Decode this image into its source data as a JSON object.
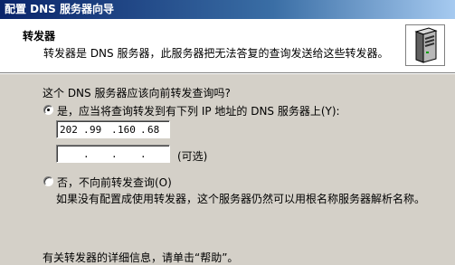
{
  "window": {
    "title": "配置 DNS 服务器向导"
  },
  "header": {
    "title": "转发器",
    "subtitle": "转发器是 DNS 服务器，此服务器把无法答复的查询发送给这些转发器。",
    "icon": "server-tower-icon"
  },
  "main": {
    "question": "这个 DNS 服务器应该向前转发查询吗?",
    "option_yes": {
      "label": "是，应当将查询转发到有下列 IP 地址的 DNS 服务器上(Y):",
      "selected": true
    },
    "ip_primary": {
      "octets": [
        "202",
        "99",
        "160",
        "68"
      ]
    },
    "ip_secondary": {
      "octets": [
        "",
        "",
        "",
        ""
      ]
    },
    "optional_label": "(可选)",
    "option_no": {
      "label": "否，不向前转发查询(O)",
      "selected": false
    },
    "description": "如果没有配置成使用转发器，这个服务器仍然可以用根名称服务器解析名称。",
    "help_text": "有关转发器的详细信息，请单击“帮助”。"
  }
}
